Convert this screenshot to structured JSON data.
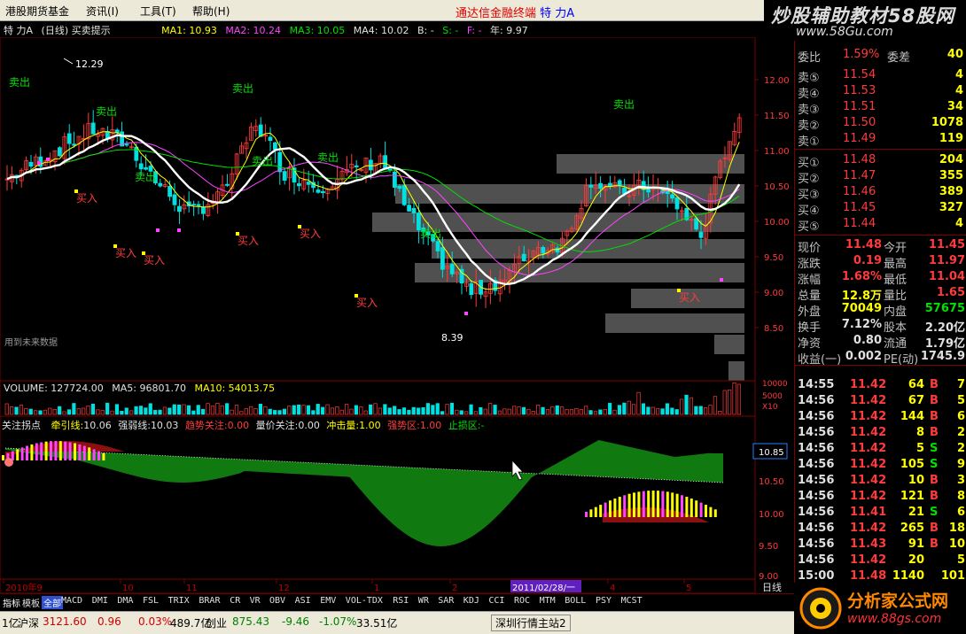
{
  "menubar": {
    "items": [
      "港股期货基金",
      "资讯(I)",
      "工具(T)",
      "帮助(H)"
    ],
    "center_prefix": "通达信金融终端",
    "center_stock": "特 力A"
  },
  "logo": {
    "line1": "炒股辅助教材58股网",
    "line2": "www.58Gu.com"
  },
  "info": {
    "stock": "特 力A",
    "period": "(日线) 买卖提示",
    "ma1": "MA1: 10.93",
    "ma2": "MA2: 10.24",
    "ma3": "MA3: 10.05",
    "ma4": "MA4: 10.02",
    "b": "B: -",
    "s": "S: -",
    "f": "F: -",
    "nian": "年: 9.97"
  },
  "colors": {
    "up": "#ff3b3b",
    "down": "#00e0e0",
    "ma1": "#ffff00",
    "ma2": "#ff44ff",
    "ma3": "#00e000",
    "bg": "#000000",
    "grid": "#7a0000"
  },
  "main_chart": {
    "high_label": "12.29",
    "low_label": "8.39",
    "future_label": "用到未来数据",
    "price_axis": [
      "12.00",
      "11.50",
      "11.00",
      "10.50",
      "10.00",
      "9.50",
      "9.00",
      "8.50"
    ],
    "sell_label": "卖出",
    "buy_label": "买入"
  },
  "volume": {
    "title": "VOLUME: 127724.00",
    "ma5": "MA5: 96801.70",
    "ma10": "MA10: 54013.75",
    "axis": [
      "10000",
      "5000",
      "X10"
    ]
  },
  "indicator": {
    "items": [
      {
        "label": "关注拐点",
        "value": ""
      },
      {
        "label": "牵引线:",
        "value": "10.06"
      },
      {
        "label": "强弱线:",
        "value": "10.03"
      },
      {
        "label": "趋势关注:",
        "value": "0.00"
      },
      {
        "label": "量价关注:",
        "value": "0.00"
      },
      {
        "label": "冲击量:",
        "value": "1.00"
      },
      {
        "label": "强势区:",
        "value": "1.00"
      },
      {
        "label": "止损区:",
        "value": "-"
      }
    ],
    "axis": [
      "10.85",
      "10.50",
      "10.00",
      "9.50",
      "9.00"
    ]
  },
  "date_axis": {
    "labels": [
      "2010年9",
      "10",
      "11",
      "12",
      "1",
      "2",
      "4",
      "5"
    ],
    "cursor_date": "2011/02/28/一",
    "period": "日线"
  },
  "right_panel": {
    "wei": {
      "label1": "委比",
      "value1": "1.59%",
      "label2": "委差",
      "value2": "40"
    },
    "sell": [
      {
        "label": "卖⑤",
        "price": "11.54",
        "vol": "4"
      },
      {
        "label": "卖④",
        "price": "11.53",
        "vol": "4"
      },
      {
        "label": "卖③",
        "price": "11.51",
        "vol": "34"
      },
      {
        "label": "卖②",
        "price": "11.50",
        "vol": "1078"
      },
      {
        "label": "卖①",
        "price": "11.49",
        "vol": "119"
      }
    ],
    "buy": [
      {
        "label": "买①",
        "price": "11.48",
        "vol": "204"
      },
      {
        "label": "买②",
        "price": "11.47",
        "vol": "355"
      },
      {
        "label": "买③",
        "price": "11.46",
        "vol": "389"
      },
      {
        "label": "买④",
        "price": "11.45",
        "vol": "327"
      },
      {
        "label": "买⑤",
        "price": "11.44",
        "vol": "4"
      }
    ],
    "quote": [
      {
        "l1": "现价",
        "v1": "11.48",
        "l2": "今开",
        "v2": "11.45"
      },
      {
        "l1": "涨跌",
        "v1": "0.19",
        "l2": "最高",
        "v2": "11.97"
      },
      {
        "l1": "涨幅",
        "v1": "1.68%",
        "l2": "最低",
        "v2": "11.04"
      },
      {
        "l1": "总量",
        "v1": "12.8万",
        "l2": "量比",
        "v2": "1.65"
      },
      {
        "l1": "外盘",
        "v1": "70049",
        "l2": "内盘",
        "v2": "57675"
      },
      {
        "l1": "换手",
        "v1": "7.12%",
        "l2": "股本",
        "v2": "2.20亿"
      },
      {
        "l1": "净资",
        "v1": "0.80",
        "l2": "流通",
        "v2": "1.79亿"
      },
      {
        "l1": "收益(一)",
        "v1": "0.002",
        "l2": "PE(动)",
        "v2": "1745.9"
      }
    ],
    "ticks": [
      {
        "time": "14:55",
        "price": "11.42",
        "vol": "64",
        "bs": "B",
        "n": "7"
      },
      {
        "time": "14:56",
        "price": "11.42",
        "vol": "67",
        "bs": "B",
        "n": "5"
      },
      {
        "time": "14:56",
        "price": "11.42",
        "vol": "144",
        "bs": "B",
        "n": "6"
      },
      {
        "time": "14:56",
        "price": "11.42",
        "vol": "8",
        "bs": "B",
        "n": "2"
      },
      {
        "time": "14:56",
        "price": "11.42",
        "vol": "5",
        "bs": "S",
        "n": "2"
      },
      {
        "time": "14:56",
        "price": "11.42",
        "vol": "105",
        "bs": "S",
        "n": "9"
      },
      {
        "time": "14:56",
        "price": "11.42",
        "vol": "10",
        "bs": "B",
        "n": "3"
      },
      {
        "time": "14:56",
        "price": "11.42",
        "vol": "121",
        "bs": "B",
        "n": "8"
      },
      {
        "time": "14:56",
        "price": "11.41",
        "vol": "21",
        "bs": "S",
        "n": "6"
      },
      {
        "time": "14:56",
        "price": "11.42",
        "vol": "265",
        "bs": "B",
        "n": "18"
      },
      {
        "time": "14:56",
        "price": "11.43",
        "vol": "91",
        "bs": "B",
        "n": "10"
      },
      {
        "time": "14:56",
        "price": "11.42",
        "vol": "20",
        "bs": "",
        "n": "5"
      },
      {
        "time": "15:00",
        "price": "11.48",
        "vol": "1140",
        "bs": "",
        "n": "101"
      }
    ]
  },
  "tabs": [
    "指标",
    "模板",
    "全部",
    "MACD",
    "DMI",
    "DMA",
    "FSL",
    "TRIX",
    "BRAR",
    "CR",
    "VR",
    "OBV",
    "ASI",
    "EMV",
    "VOL-TDX",
    "RSI",
    "WR",
    "SAR",
    "KDJ",
    "CCI",
    "ROC",
    "MTM",
    "BOLL",
    "PSY",
    "MCST"
  ],
  "status": {
    "s0": "1亿",
    "s1": "沪深",
    "s2": "3121.60",
    "s3": "0.96",
    "s4": "0.03%",
    "s5": "489.7亿",
    "s6": "创业",
    "s7": "875.43",
    "s8": "-9.46",
    "s9": "-1.07%",
    "s10": "33.51亿",
    "s11": "深圳行情主站2"
  },
  "ad": {
    "line1": "分析家公式网",
    "line2": "www.88gs.com"
  }
}
